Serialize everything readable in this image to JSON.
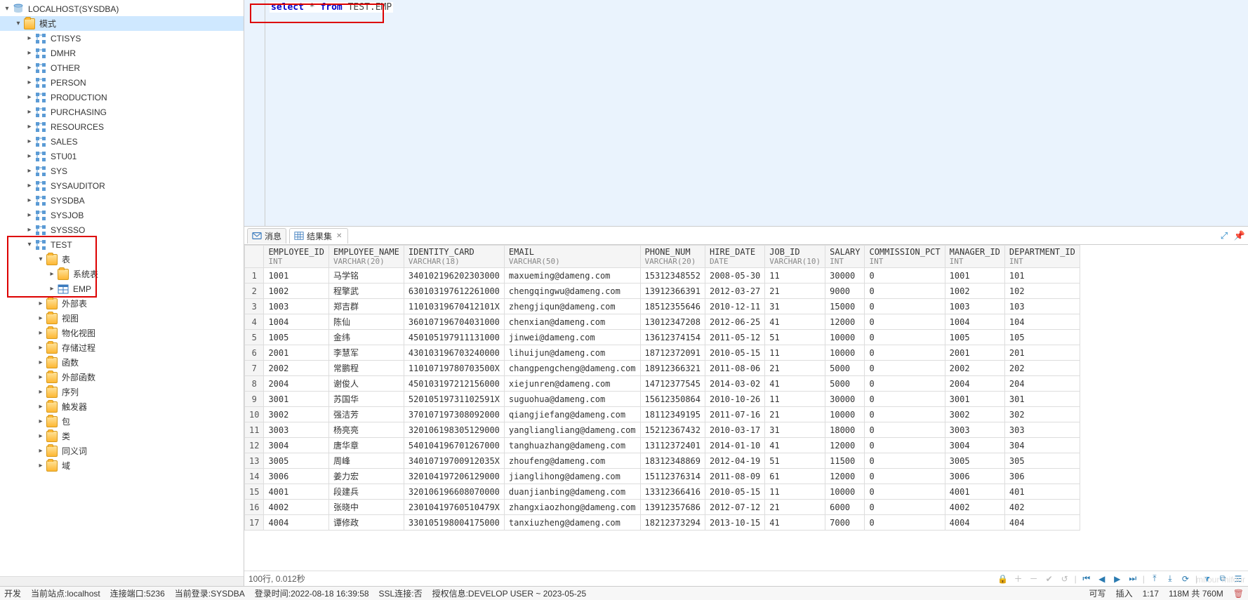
{
  "sidebar": {
    "root": "LOCALHOST(SYSDBA)",
    "mode_label": "模式",
    "schemas": [
      "CTISYS",
      "DMHR",
      "OTHER",
      "PERSON",
      "PRODUCTION",
      "PURCHASING",
      "RESOURCES",
      "SALES",
      "STU01",
      "SYS",
      "SYSAUDITOR",
      "SYSDBA",
      "SYSJOB",
      "SYSSSO",
      "TEST"
    ],
    "test_children": {
      "tables_label": "表",
      "sys_tables_label": "系统表",
      "emp_label": "EMP",
      "others": [
        "外部表",
        "视图",
        "物化视图",
        "存储过程",
        "函数",
        "外部函数",
        "序列",
        "触发器",
        "包",
        "类",
        "同义词",
        "域"
      ]
    }
  },
  "editor": {
    "sql_kw1": "select",
    "sql_star": " * ",
    "sql_kw2": "from",
    "sql_ident": " TEST.EMP"
  },
  "tabs": {
    "msg": "消息",
    "results": "结果集"
  },
  "columns": [
    {
      "name": "EMPLOYEE_ID",
      "type": "INT"
    },
    {
      "name": "EMPLOYEE_NAME",
      "type": "VARCHAR(20)"
    },
    {
      "name": "IDENTITY_CARD",
      "type": "VARCHAR(18)"
    },
    {
      "name": "EMAIL",
      "type": "VARCHAR(50)"
    },
    {
      "name": "PHONE_NUM",
      "type": "VARCHAR(20)"
    },
    {
      "name": "HIRE_DATE",
      "type": "DATE"
    },
    {
      "name": "JOB_ID",
      "type": "VARCHAR(10)"
    },
    {
      "name": "SALARY",
      "type": "INT"
    },
    {
      "name": "COMMISSION_PCT",
      "type": "INT"
    },
    {
      "name": "MANAGER_ID",
      "type": "INT"
    },
    {
      "name": "DEPARTMENT_ID",
      "type": "INT"
    }
  ],
  "rows": [
    [
      "1001",
      "马学铭",
      "340102196202303000",
      "maxueming@dameng.com",
      "15312348552",
      "2008-05-30",
      "11",
      "30000",
      "0",
      "1001",
      "101"
    ],
    [
      "1002",
      "程擎武",
      "630103197612261000",
      "chengqingwu@dameng.com",
      "13912366391",
      "2012-03-27",
      "21",
      "9000",
      "0",
      "1002",
      "102"
    ],
    [
      "1003",
      "郑吉群",
      "11010319670412101X",
      "zhengjiqun@dameng.com",
      "18512355646",
      "2010-12-11",
      "31",
      "15000",
      "0",
      "1003",
      "103"
    ],
    [
      "1004",
      "陈仙",
      "360107196704031000",
      "chenxian@dameng.com",
      "13012347208",
      "2012-06-25",
      "41",
      "12000",
      "0",
      "1004",
      "104"
    ],
    [
      "1005",
      "金纬",
      "450105197911131000",
      "jinwei@dameng.com",
      "13612374154",
      "2011-05-12",
      "51",
      "10000",
      "0",
      "1005",
      "105"
    ],
    [
      "2001",
      "李慧军",
      "430103196703240000",
      "lihuijun@dameng.com",
      "18712372091",
      "2010-05-15",
      "11",
      "10000",
      "0",
      "2001",
      "201"
    ],
    [
      "2002",
      "常鹏程",
      "11010719780703500X",
      "changpengcheng@dameng.com",
      "18912366321",
      "2011-08-06",
      "21",
      "5000",
      "0",
      "2002",
      "202"
    ],
    [
      "2004",
      "谢俊人",
      "450103197212156000",
      "xiejunren@dameng.com",
      "14712377545",
      "2014-03-02",
      "41",
      "5000",
      "0",
      "2004",
      "204"
    ],
    [
      "3001",
      "苏国华",
      "52010519731102591X",
      "suguohua@dameng.com",
      "15612350864",
      "2010-10-26",
      "11",
      "30000",
      "0",
      "3001",
      "301"
    ],
    [
      "3002",
      "强洁芳",
      "370107197308092000",
      "qiangjiefang@dameng.com",
      "18112349195",
      "2011-07-16",
      "21",
      "10000",
      "0",
      "3002",
      "302"
    ],
    [
      "3003",
      "杨亮亮",
      "320106198305129000",
      "yangliangliang@dameng.com",
      "15212367432",
      "2010-03-17",
      "31",
      "18000",
      "0",
      "3003",
      "303"
    ],
    [
      "3004",
      "唐华章",
      "540104196701267000",
      "tanghuazhang@dameng.com",
      "13112372401",
      "2014-01-10",
      "41",
      "12000",
      "0",
      "3004",
      "304"
    ],
    [
      "3005",
      "周峰",
      "34010719700912035X",
      "zhoufeng@dameng.com",
      "18312348869",
      "2012-04-19",
      "51",
      "11500",
      "0",
      "3005",
      "305"
    ],
    [
      "3006",
      "姜力宏",
      "320104197206129000",
      "jianglihong@dameng.com",
      "15112376314",
      "2011-08-09",
      "61",
      "12000",
      "0",
      "3006",
      "306"
    ],
    [
      "4001",
      "段建兵",
      "320106196608070000",
      "duanjianbing@dameng.com",
      "13312366416",
      "2010-05-15",
      "11",
      "10000",
      "0",
      "4001",
      "401"
    ],
    [
      "4002",
      "张晓中",
      "23010419760510479X",
      "zhangxiaozhong@dameng.com",
      "13912357686",
      "2012-07-12",
      "21",
      "6000",
      "0",
      "4002",
      "402"
    ],
    [
      "4004",
      "谭修政",
      "330105198004175000",
      "tanxiuzheng@dameng.com",
      "18212373294",
      "2013-10-15",
      "41",
      "7000",
      "0",
      "4004",
      "404"
    ]
  ],
  "grid_status": "100行, 0.012秒",
  "statusbar": {
    "dev": "开发",
    "site": "当前站点:localhost",
    "port": "连接端口:5236",
    "login": "当前登录:SYSDBA",
    "login_time": "登录时间:2022-08-18 16:39:58",
    "ssl": "SSL连接:否",
    "auth": "授权信息:DEVELOP USER ~ 2023-05-25",
    "writable": "可写",
    "insert": "插入",
    "pos": "1:17",
    "mem": "118M 共 760M"
  },
  "watermark": "mifour mifour"
}
